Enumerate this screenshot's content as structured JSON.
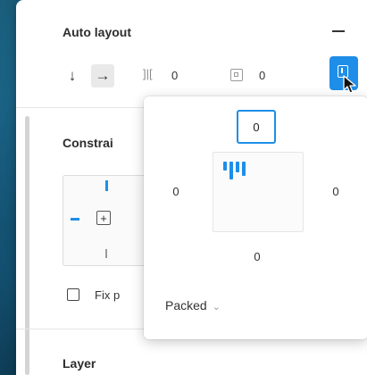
{
  "auto_layout": {
    "title": "Auto layout",
    "direction_down_icon": "↓",
    "direction_right_icon": "→",
    "spacing_icon": "]|[",
    "spacing_value": "0",
    "padding_value": "0"
  },
  "constraints": {
    "title_partial": "Constrai",
    "center_symbol": "+"
  },
  "fix_position": {
    "label_partial": "Fix p"
  },
  "layer": {
    "title": "Layer"
  },
  "padding_popover": {
    "top": "0",
    "left": "0",
    "right": "0",
    "bottom": "0",
    "spacing_mode": "Packed",
    "chevron": "⌄"
  },
  "colors": {
    "accent": "#1e8ee8",
    "background_gradient": [
      "#1f6f93",
      "#0e3f5c"
    ]
  }
}
